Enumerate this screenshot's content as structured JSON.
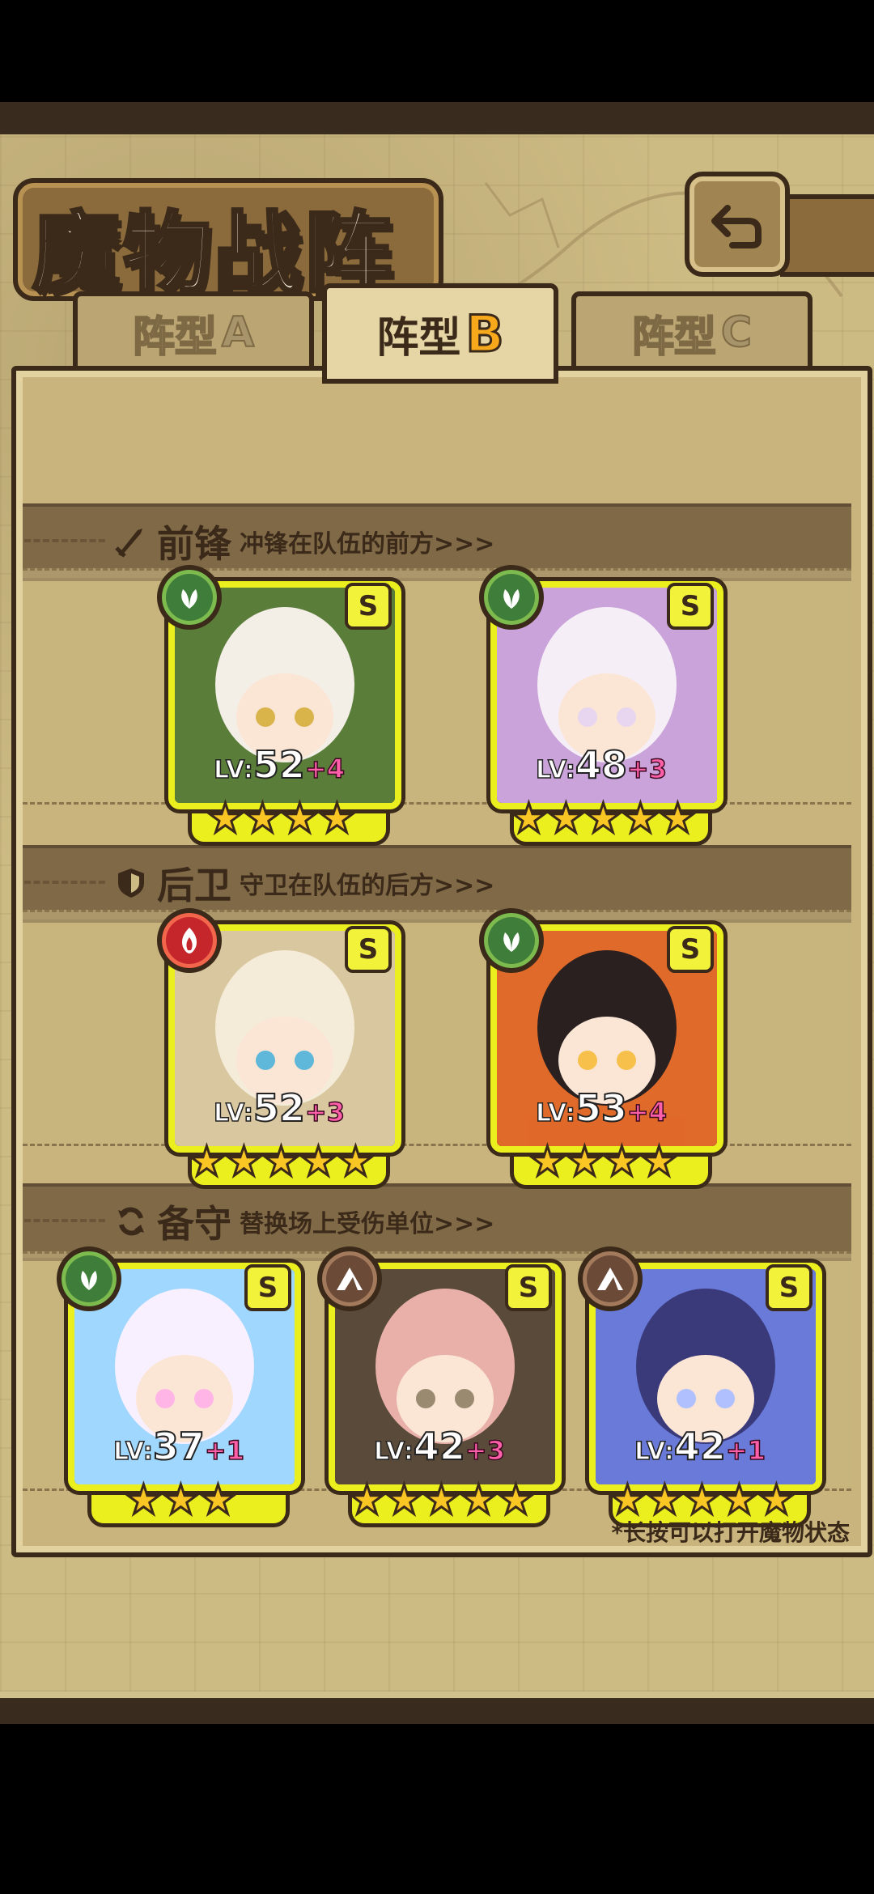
{
  "title": "魔物战阵",
  "tabs": [
    {
      "label": "阵型",
      "letter": "A",
      "active": false
    },
    {
      "label": "阵型",
      "letter": "B",
      "active": true
    },
    {
      "label": "阵型",
      "letter": "C",
      "active": false
    }
  ],
  "sections": {
    "front": {
      "title": "前锋",
      "subtitle": "冲锋在队伍的前方>>>"
    },
    "back": {
      "title": "后卫",
      "subtitle": "守卫在队伍的后方>>>"
    },
    "reserve": {
      "title": "备守",
      "subtitle": "替换场上受伤单位>>>"
    }
  },
  "units": [
    {
      "rank": "S",
      "element": "green",
      "lv_label": "LV:",
      "lv": "52",
      "plus": "+4",
      "stars": "★★★★",
      "star_count": 4
    },
    {
      "rank": "S",
      "element": "green",
      "lv_label": "LV:",
      "lv": "48",
      "plus": "+3",
      "stars": "★★★★★",
      "star_count": 5
    },
    {
      "rank": "S",
      "element": "red",
      "lv_label": "LV:",
      "lv": "52",
      "plus": "+3",
      "stars": "★★★★★",
      "star_count": 5
    },
    {
      "rank": "S",
      "element": "green",
      "lv_label": "LV:",
      "lv": "53",
      "plus": "+4",
      "stars": "★★★★",
      "star_count": 4
    },
    {
      "rank": "S",
      "element": "green",
      "lv_label": "LV:",
      "lv": "37",
      "plus": "+1",
      "stars": "★★★",
      "star_count": 3
    },
    {
      "rank": "S",
      "element": "brown",
      "lv_label": "LV:",
      "lv": "42",
      "plus": "+3",
      "stars": "★★★★★",
      "star_count": 5
    },
    {
      "rank": "S",
      "element": "brown",
      "lv_label": "LV:",
      "lv": "42",
      "plus": "+1",
      "stars": "★★★★★",
      "star_count": 5
    }
  ],
  "hint": "*长按可以打开魔物状态",
  "colors": {
    "card_border": "#ecef1e",
    "accent": "#f7a91b",
    "plus": "#ff5fa8"
  }
}
